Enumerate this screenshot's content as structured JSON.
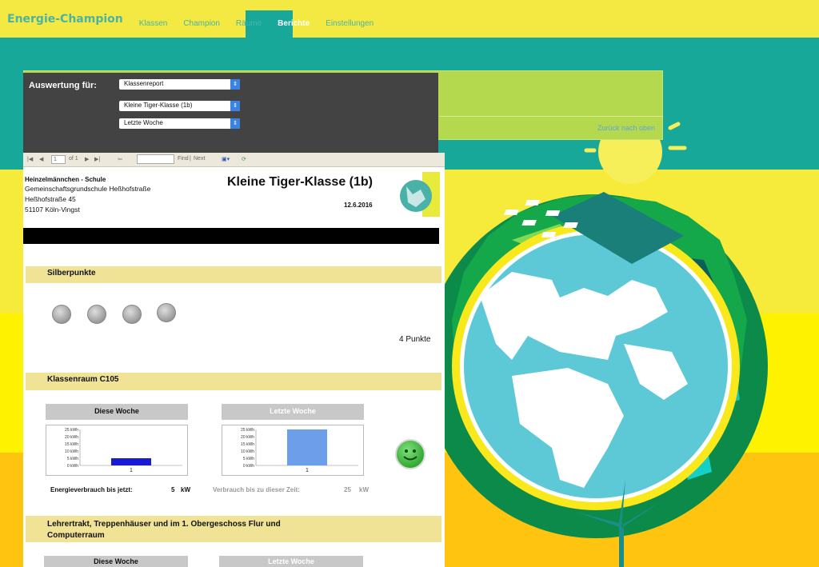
{
  "nav": {
    "brand": "Energie-Champion",
    "items": [
      "Klassen",
      "Champion",
      "Räume",
      "Berichte",
      "Einstellungen"
    ],
    "active": "Berichte"
  },
  "back_to_top": "Zurück nach oben",
  "filter": {
    "label": "Auswertung für:",
    "report_type": "Klassenreport",
    "class": "Kleine Tiger-Klasse (1b)",
    "period": "Letzte Woche"
  },
  "toolbar": {
    "page": "1",
    "of_label": "of 1",
    "find_label": "Find",
    "next_label": "Next"
  },
  "report": {
    "school_name": "Heinzelmännchen - Schule",
    "address_lines": [
      "Gemeinschaftsgrundschule Heßhofstraße",
      "Heßhofstraße 45",
      "51107 Köln-Vingst"
    ],
    "title": "Kleine Tiger-Klasse (1b)",
    "date": "12.6.2016",
    "silver_section": "Silberpunkte",
    "silver_count": 4,
    "points_label": "4 Punkte",
    "room_section": "Klassenraum C105",
    "this_week": "Diese Woche",
    "last_week": "Letzte Woche",
    "consumption_label": "Energieverbrauch bis jetzt:",
    "consumption_value": "5",
    "consumption_unit": "kW",
    "compare_label": "Verbrauch bis zu dieser Zeit:",
    "compare_value": "25",
    "compare_unit": "kW",
    "second_section_line1": "Lehrertrakt, Treppenhäuser und im 1. Obergeschoss Flur und",
    "second_section_line2": "Computerraum",
    "second_this_week": "Diese Woche",
    "second_last_week": "Letzte Woche"
  },
  "chart_data": [
    {
      "type": "bar",
      "title": "Diese Woche",
      "categories": [
        "1"
      ],
      "values": [
        5
      ],
      "yticks": [
        "25 kWh",
        "20 kWh",
        "15 kWh",
        "10 kWh",
        "5 kWh",
        "0 kWh"
      ],
      "ylim": [
        0,
        25
      ],
      "color": "#1a1ad6"
    },
    {
      "type": "bar",
      "title": "Letzte Woche",
      "categories": [
        "1"
      ],
      "values": [
        25
      ],
      "yticks": [
        "25 kWh",
        "20 kWh",
        "15 kWh",
        "10 kWh",
        "5 kWh",
        "0 kWh"
      ],
      "ylim": [
        0,
        25
      ],
      "color": "#6d9eea"
    }
  ],
  "colors": {
    "teal": "#17a89a",
    "yellow": "#f6ea3a",
    "accent_green": "#b5d94e",
    "panel": "#434343"
  }
}
